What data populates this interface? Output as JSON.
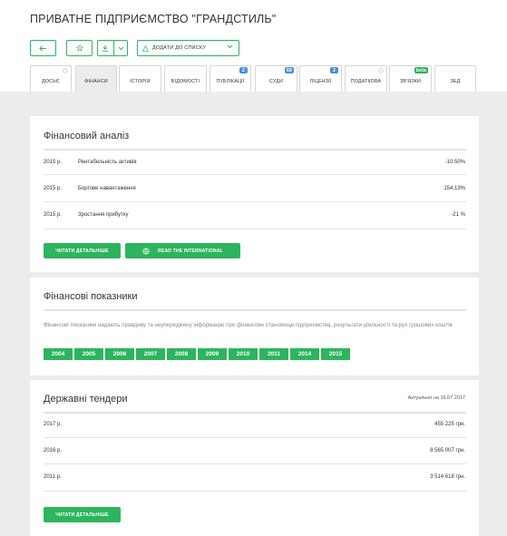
{
  "header": {
    "title": "ПРИВАТНЕ ПІДПРИЄМСТВО \"ГРАНДСТИЛЬ\"",
    "add_to_list_label": "ДОДАТИ ДО СПИСКУ"
  },
  "tabs": [
    {
      "label": "ДОСЬЄ"
    },
    {
      "label": "ФІНАНСИ",
      "active": true
    },
    {
      "label": "ІСТОРІЯ"
    },
    {
      "label": "ВІДОМОСТІ"
    },
    {
      "label": "ПУБЛІКАЦІЇ",
      "badge": "2"
    },
    {
      "label": "СУДИ",
      "badge": "68"
    },
    {
      "label": "ЛІЦЕНЗІЇ",
      "badge": "3"
    },
    {
      "label": "ПОДАТКОВА"
    },
    {
      "label": "ЗВ'ЯЗКИ",
      "badge": "beta"
    },
    {
      "label": "ЗЕД"
    }
  ],
  "financial_analysis": {
    "title": "Фінансовий аналіз",
    "rows": [
      {
        "year": "2015 р.",
        "label": "Рентабельність активів",
        "value": "-10.50%"
      },
      {
        "year": "2015 р.",
        "label": "Боргове навантаження",
        "value": "154.19%"
      },
      {
        "year": "2015 р.",
        "label": "Зростання прибутку",
        "value": "-21 %"
      }
    ],
    "details_label": "ЧИТАТИ ДЕТАЛЬНІШЕ",
    "international_label": "READ THE INTERNATIONAL"
  },
  "financial_indicators": {
    "title": "Фінансові показники",
    "description": "Фінансові показники надають правдиву та неупереджену інформацію про фінансове становище підприємства, результати діяльності та рух грошових коштів",
    "years": [
      "2004",
      "2005",
      "2006",
      "2007",
      "2008",
      "2009",
      "2010",
      "2011",
      "2014",
      "2015"
    ]
  },
  "tenders": {
    "title": "Державні тендери",
    "actual_note": "Актуально на 16.07.2017",
    "rows": [
      {
        "year": "2017 р.",
        "value": "455 225 грн."
      },
      {
        "year": "2016 р.",
        "value": "8 565 007 грн."
      },
      {
        "year": "2011 р.",
        "value": "3 514 618 грн."
      }
    ],
    "details_label": "ЧИТАТИ ДЕТАЛЬНІШЕ"
  },
  "colors": {
    "accent": "#2db55d",
    "badge_blue": "#4a90d9",
    "background": "#ececec"
  }
}
